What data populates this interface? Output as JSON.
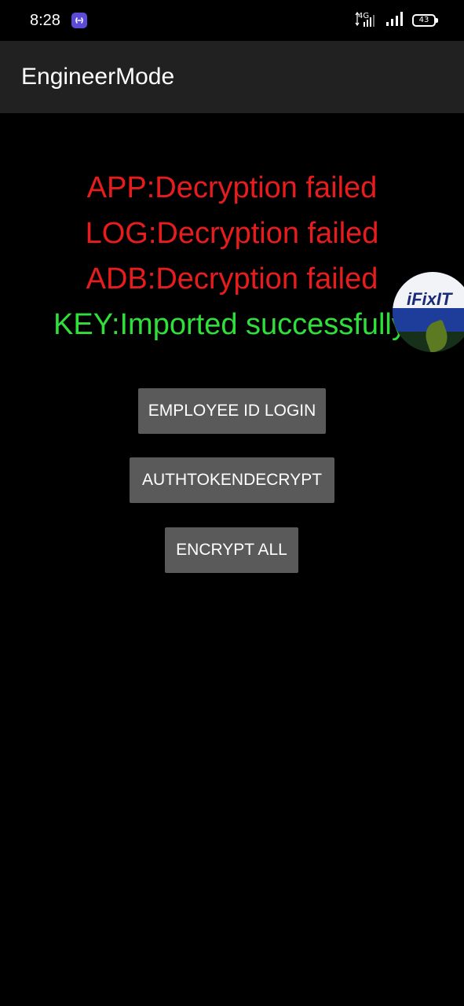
{
  "status_bar": {
    "time": "8:28",
    "network_label": "4G",
    "battery_level": "43",
    "icons": [
      "app-notification-icon",
      "data-arrows-icon",
      "signal-icon-1",
      "signal-icon-2",
      "battery-icon"
    ]
  },
  "app_bar": {
    "title": "EngineerMode"
  },
  "status": {
    "app": "APP:Decryption failed",
    "log": "LOG:Decryption failed",
    "adb": "ADB:Decryption failed",
    "key": "KEY:Imported successfully"
  },
  "floating_bubble": {
    "brand": "iFixIT"
  },
  "buttons": {
    "employee_login": "EMPLOYEE ID LOGIN",
    "auth_token_decrypt": "AUTHTOKENDECRYPT",
    "encrypt_all": "ENCRYPT ALL"
  },
  "colors": {
    "fail": "#e81c1c",
    "success": "#2fe03a",
    "button": "#5a5a5a",
    "app_bar": "#212121",
    "background": "#000000"
  }
}
